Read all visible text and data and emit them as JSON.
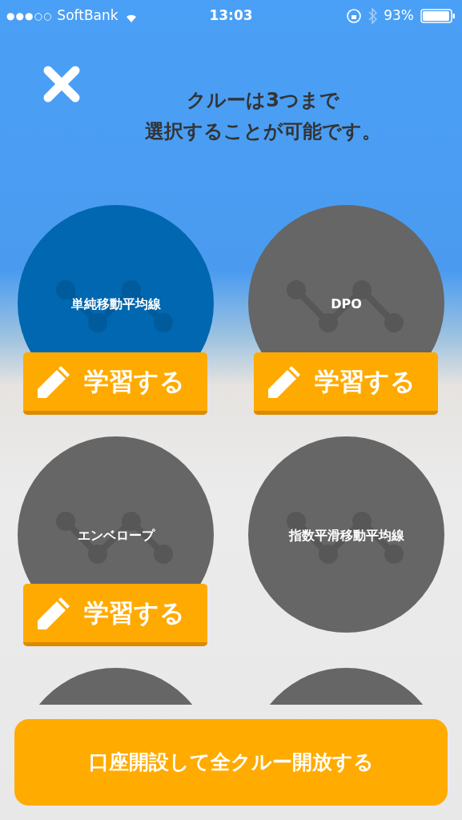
{
  "status_bar": {
    "signal": "●●●○○",
    "carrier": "SoftBank",
    "time": "13:03",
    "battery": "93%"
  },
  "title_lines": [
    "クルーは3つまで",
    "選択することが可能です。"
  ],
  "crews": [
    {
      "name": "単純移動平均線",
      "selected": true,
      "learn_label": "学習する"
    },
    {
      "name": "DPO",
      "selected": false,
      "learn_label": "学習する"
    },
    {
      "name": "エンベロープ",
      "selected": false,
      "learn_label": "学習する"
    },
    {
      "name": "指数平滑移動平均線",
      "selected": false
    },
    {
      "selected": false
    },
    {
      "selected": false
    }
  ],
  "open_all_button": "口座開設して全クルー開放する"
}
